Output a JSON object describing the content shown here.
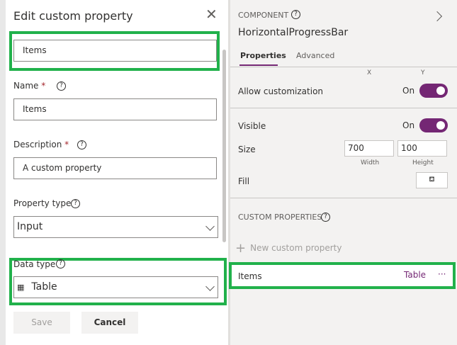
{
  "dialog": {
    "title": "Edit custom property",
    "display_name_value": "Items",
    "name_label": "Name",
    "name_value": "Items",
    "description_label": "Description",
    "description_value": "A custom property",
    "required_mark": "*",
    "property_type_label": "Property type",
    "property_type_value": "Input",
    "data_type_label": "Data type",
    "data_type_value": "Table",
    "save_label": "Save",
    "cancel_label": "Cancel",
    "help_glyph": "?"
  },
  "panel": {
    "section_label": "COMPONENT",
    "component_name": "HorizontalProgressBar",
    "tabs": [
      "Properties",
      "Advanced"
    ],
    "x_label": "X",
    "y_label": "Y",
    "allow_customization_label": "Allow customization",
    "allow_customization_state": "On",
    "visible_label": "Visible",
    "visible_state": "On",
    "size_label": "Size",
    "width_value": "700",
    "height_value": "100",
    "width_label": "Width",
    "height_label": "Height",
    "fill_label": "Fill",
    "custom_properties_label": "CUSTOM PROPERTIES",
    "new_custom_property_label": "New custom property",
    "custom_property": {
      "name": "Items",
      "type": "Table",
      "more": "···"
    }
  },
  "colors": {
    "accent": "#742774",
    "highlight": "#21b14b"
  }
}
